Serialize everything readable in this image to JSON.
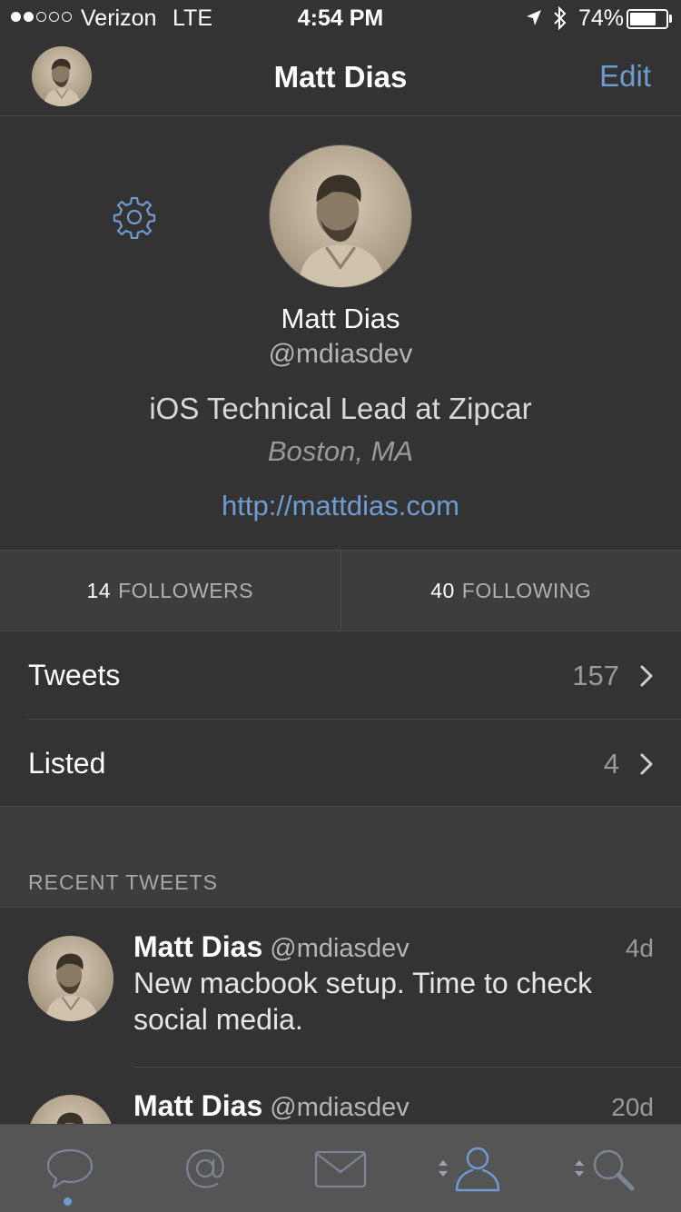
{
  "status_bar": {
    "carrier": "Verizon",
    "network": "LTE",
    "time": "4:54 PM",
    "battery": "74%",
    "battery_level": 0.74,
    "signal_bars": 2,
    "signal_total": 5
  },
  "nav": {
    "title": "Matt Dias",
    "edit_label": "Edit"
  },
  "profile": {
    "name": "Matt Dias",
    "handle": "@mdiasdev",
    "bio": "iOS Technical Lead at Zipcar",
    "location": "Boston, MA",
    "url": "http://mattdias.com"
  },
  "stats": {
    "followers_count": "14",
    "followers_label": "FOLLOWERS",
    "following_count": "40",
    "following_label": "FOLLOWING"
  },
  "rows": [
    {
      "label": "Tweets",
      "value": "157"
    },
    {
      "label": "Listed",
      "value": "4"
    }
  ],
  "recent": {
    "title": "RECENT TWEETS",
    "tweets": [
      {
        "name": "Matt Dias",
        "handle": "@mdiasdev",
        "time": "4d",
        "text": "New macbook setup. Time to check social media."
      },
      {
        "name": "Matt Dias",
        "handle": "@mdiasdev",
        "time": "20d",
        "text": ""
      }
    ]
  },
  "tabs": [
    {
      "icon": "speech-bubble-icon",
      "active": true
    },
    {
      "icon": "at-sign-icon",
      "active": false
    },
    {
      "icon": "envelope-icon",
      "active": false
    },
    {
      "icon": "person-icon",
      "active": false,
      "selected": true
    },
    {
      "icon": "search-icon",
      "active": false
    }
  ],
  "colors": {
    "background": "#333333",
    "accent": "#6f9bd1",
    "tab_bar": "#555555"
  }
}
